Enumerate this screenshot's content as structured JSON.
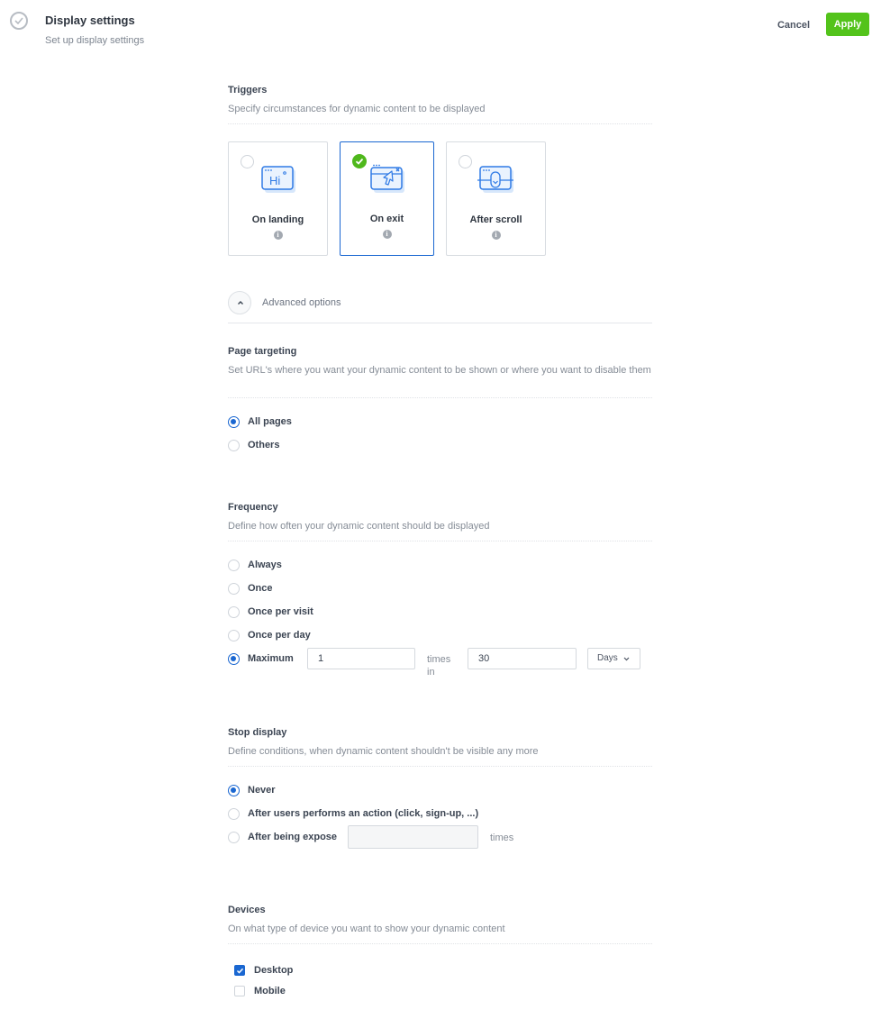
{
  "header": {
    "icon": "check-circle-icon",
    "title": "Display settings",
    "subtitle": "Set up display settings",
    "cancel_label": "Cancel",
    "apply_label": "Apply",
    "apply_color": "#53c31b"
  },
  "triggers": {
    "title": "Triggers",
    "description": "Specify circumstances for dynamic content to be displayed",
    "cards": [
      {
        "label": "On landing",
        "icon": "hi-window-icon",
        "selected": false
      },
      {
        "label": "On exit",
        "icon": "exit-cursor-window-icon",
        "selected": true
      },
      {
        "label": "After scroll",
        "icon": "scroll-mouse-window-icon",
        "selected": false
      }
    ],
    "info_glyph": "i"
  },
  "advanced": {
    "label": "Advanced options",
    "expanded": true
  },
  "page_targeting": {
    "title": "Page targeting",
    "description": "Set URL's where you want your dynamic content to be shown or where you want to disable them",
    "options": [
      {
        "label": "All pages",
        "selected": true
      },
      {
        "label": "Others",
        "selected": false
      }
    ]
  },
  "frequency": {
    "title": "Frequency",
    "description": "Define how often your dynamic content should be displayed",
    "options": [
      {
        "label": "Always",
        "selected": false
      },
      {
        "label": "Once",
        "selected": false
      },
      {
        "label": "Once per visit",
        "selected": false
      },
      {
        "label": "Once per day",
        "selected": false
      },
      {
        "label": "Maximum",
        "selected": true
      }
    ],
    "maximum": {
      "times_value": "1",
      "times_in_label": "times in",
      "period_value": "30",
      "unit_selected": "Days"
    }
  },
  "stop_display": {
    "title": "Stop display",
    "description": "Define conditions, when dynamic content shouldn't be visible any more",
    "options": [
      {
        "label": "Never",
        "selected": true
      },
      {
        "label": "After users performs an action (click, sign-up, ...)",
        "selected": false
      },
      {
        "label": "After being expose",
        "selected": false
      }
    ],
    "expose_value": "",
    "times_label": "times"
  },
  "devices": {
    "title": "Devices",
    "description": "On what type of device you want to show your dynamic content",
    "options": [
      {
        "label": "Desktop",
        "checked": true
      },
      {
        "label": "Mobile",
        "checked": false
      }
    ]
  },
  "colors": {
    "primary_blue": "#1a67d1",
    "success_green": "#4fb81c"
  }
}
